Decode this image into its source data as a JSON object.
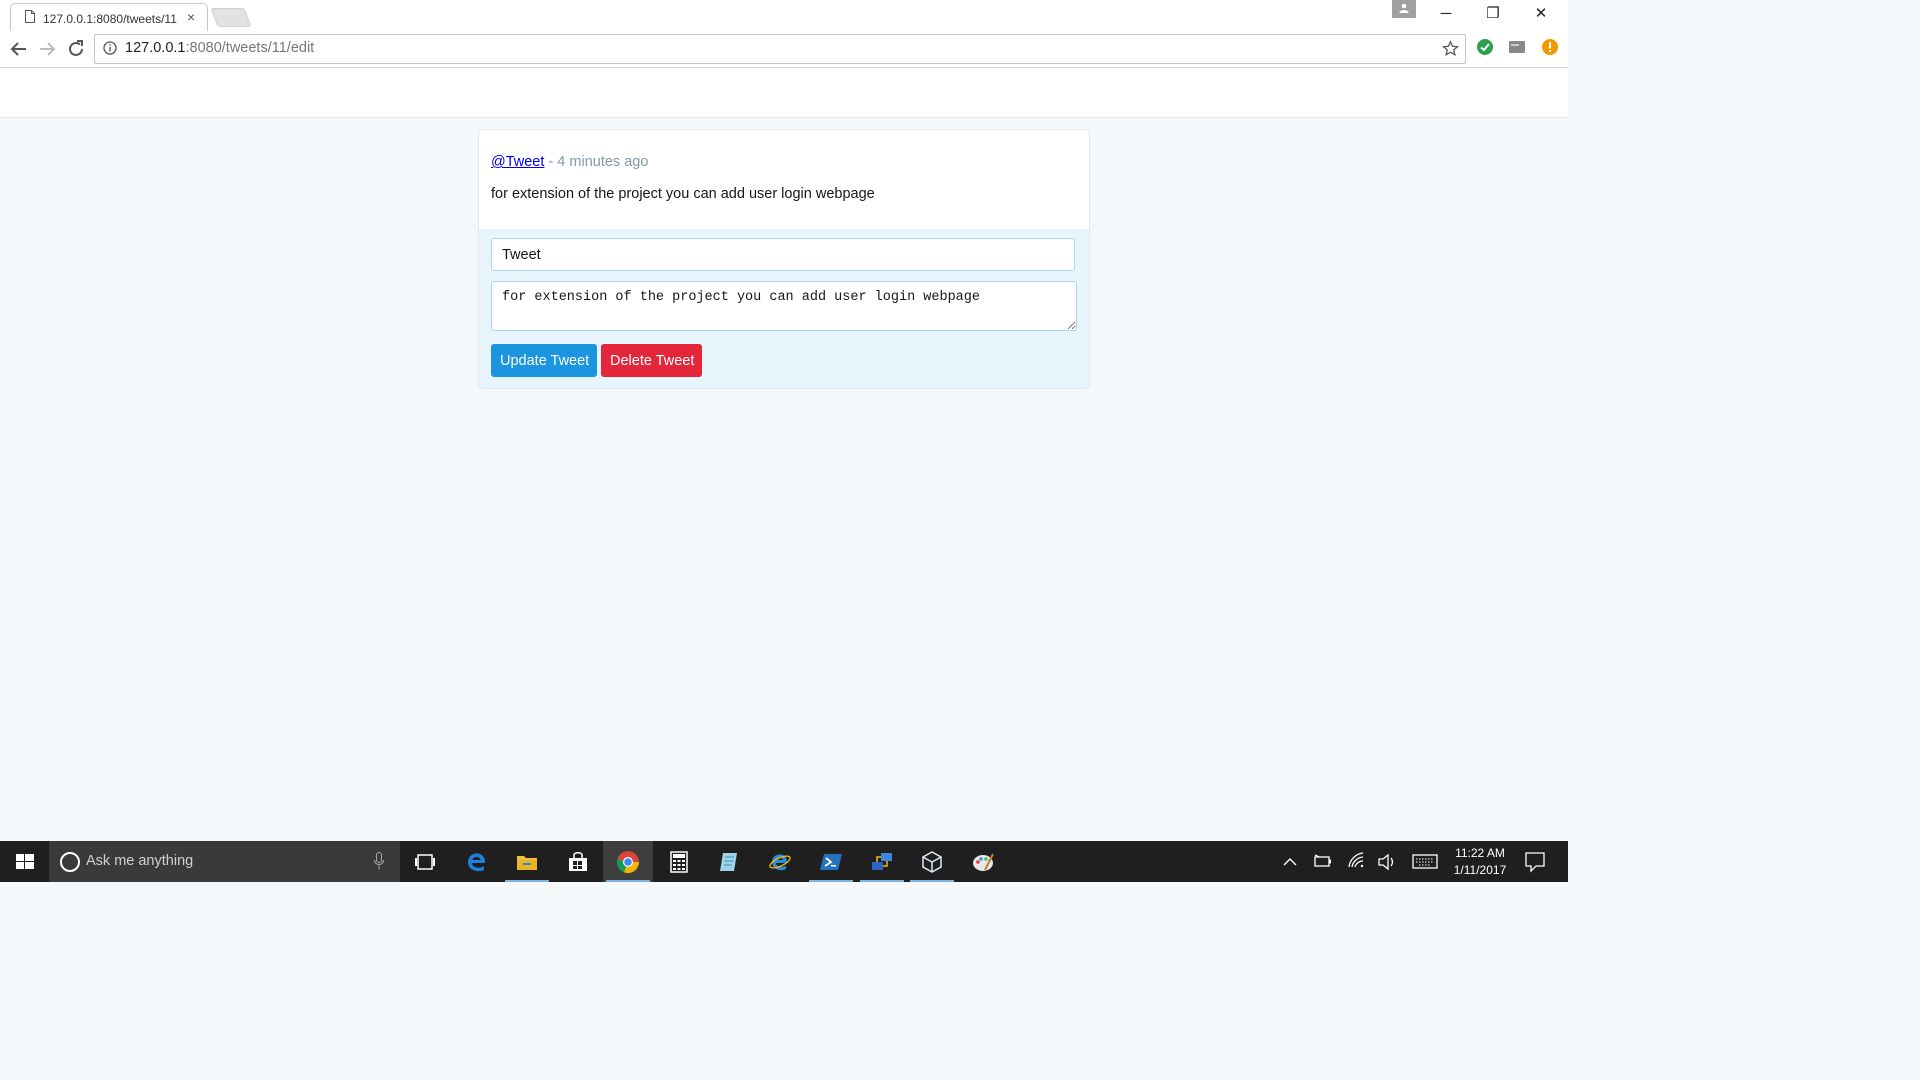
{
  "browser": {
    "tab_title": "127.0.0.1:8080/tweets/11",
    "address": {
      "host": "127.0.0.1",
      "rest": ":8080/tweets/11/edit"
    },
    "window_controls": {
      "minimize": "─",
      "restore": "❐",
      "close": "✕"
    },
    "tab_close": "×"
  },
  "tweet": {
    "handle": "@Tweet",
    "separator": " - ",
    "time": "4 minutes ago",
    "text": "for extension of the project you can add user login webpage"
  },
  "edit_form": {
    "name_value": "Tweet",
    "body_value": "for extension of the project you can add user login webpage",
    "update_label": "Update Tweet",
    "delete_label": "Delete Tweet"
  },
  "taskbar": {
    "search_placeholder": "Ask me anything",
    "time": "11:22 AM",
    "date": "1/11/2017"
  },
  "colors": {
    "update_button": "#1b95e0",
    "delete_button": "#e3263a",
    "edit_area": "#e8f5fd"
  }
}
